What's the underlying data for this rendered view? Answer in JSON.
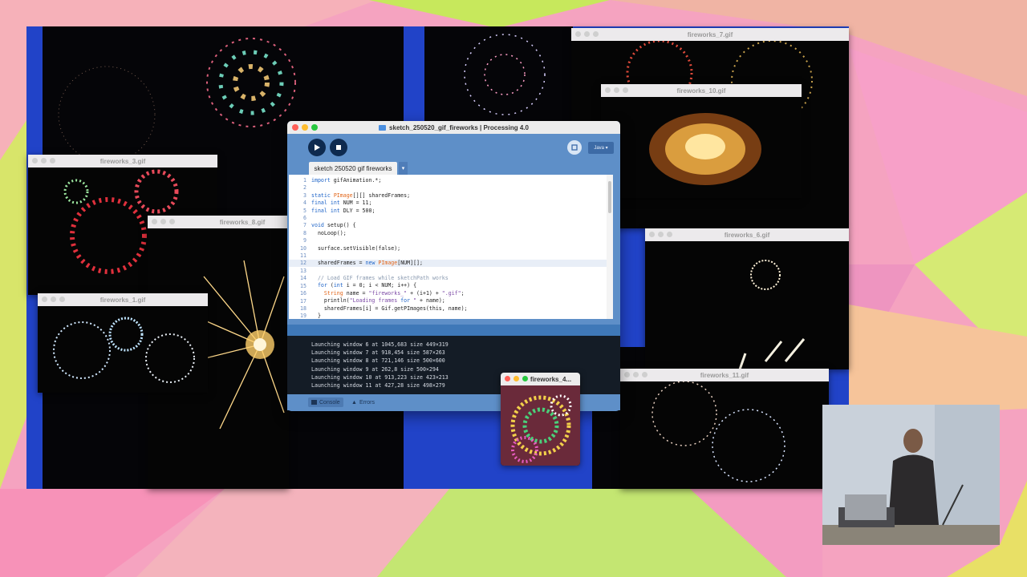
{
  "colors": {
    "desktop": "#2143c8",
    "ide_frame": "#5e8fc8",
    "console_bg": "#141c26",
    "close": "#ff5f57",
    "minimize": "#febc2e",
    "maximize": "#28c840"
  },
  "gif_windows": {
    "fw7": {
      "title": "fireworks_7.gif"
    },
    "fw10": {
      "title": "fireworks_10.gif"
    },
    "fw3": {
      "title": "fireworks_3.gif"
    },
    "fw8": {
      "title": "fireworks_8.gif"
    },
    "fw1": {
      "title": "fireworks_1.gif"
    },
    "fw6": {
      "title": "fireworks_6.gif"
    },
    "fw11": {
      "title": "fireworks_11.gif"
    },
    "fw4": {
      "title": "fireworks_4..."
    }
  },
  "ide": {
    "window_title": "sketch_250520_gif_fireworks | Processing 4.0",
    "run_icon": "play-icon",
    "stop_icon": "stop-icon",
    "debug_icon": "debug-icon",
    "mode_label": "Java ▾",
    "tab_label": "sketch 250520 gif fireworks",
    "tab_menu": "▾",
    "line_numbers": [
      "1",
      "2",
      "3",
      "4",
      "5",
      "6",
      "7",
      "8",
      "9",
      "10",
      "11",
      "12",
      "13",
      "14",
      "15",
      "16",
      "17",
      "18",
      "19"
    ],
    "code_lines": [
      "import gifAnimation.*;",
      "",
      "static PImage[][] sharedFrames;",
      "final int NUM = 11;",
      "final int DLY = 500;",
      "",
      "void setup() {",
      "  noLoop();",
      "",
      "  surface.setVisible(false);",
      "",
      "  sharedFrames = new PImage[NUM][];",
      "",
      "  // Load GIF frames while sketchPath works",
      "  for (int i = 0; i < NUM; i++) {",
      "    String name = \"fireworks_\" + (i+1) + \".gif\";",
      "    println(\"Loading frames for \" + name);",
      "    sharedFrames[i] = Gif.getPImages(this, name);",
      "  }"
    ],
    "console_lines": [
      "Launching window 6 at 1045,683 size 449×319",
      "Launching window 7 at 918,454 size 587×263",
      "Launching window 8 at 721,146 size 500×600",
      "Launching window 9 at 262,8 size 500×294",
      "Launching window 10 at 913,223 size 423×213",
      "Launching window 11 at 427,28 size 498×279"
    ],
    "console_tab": "Console",
    "errors_tab": "Errors"
  }
}
